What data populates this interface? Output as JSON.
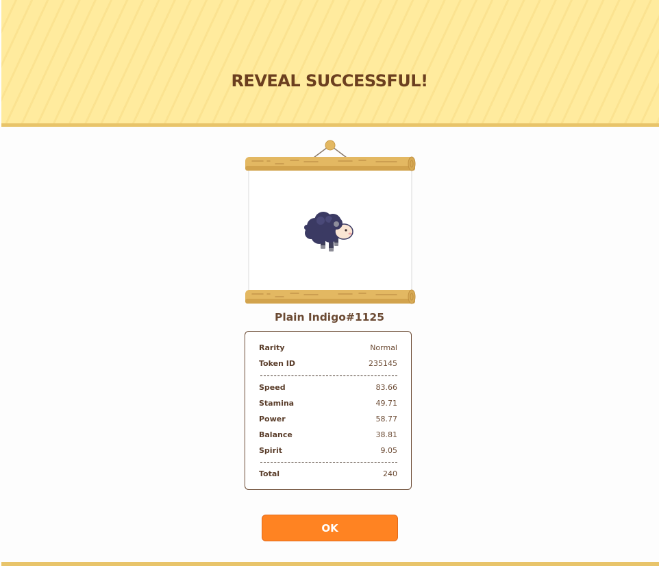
{
  "header": {
    "title": "REVEAL SUCCESSFUL!"
  },
  "nft": {
    "name": "Plain Indigo#1125",
    "image_icon": "indigo-sheep-icon"
  },
  "stats": {
    "rarity": {
      "label": "Rarity",
      "value": "Normal"
    },
    "token_id": {
      "label": "Token ID",
      "value": "235145"
    },
    "speed": {
      "label": "Speed",
      "value": "83.66"
    },
    "stamina": {
      "label": "Stamina",
      "value": "49.71"
    },
    "power": {
      "label": "Power",
      "value": "58.77"
    },
    "balance": {
      "label": "Balance",
      "value": "38.81"
    },
    "spirit": {
      "label": "Spirit",
      "value": "9.05"
    },
    "total": {
      "label": "Total",
      "value": "240"
    }
  },
  "actions": {
    "ok_label": "OK"
  },
  "colors": {
    "header_bg": "#ffeb9e",
    "accent_border": "#e8c46a",
    "button": "#ff8322",
    "text_brown": "#6b4a33"
  }
}
